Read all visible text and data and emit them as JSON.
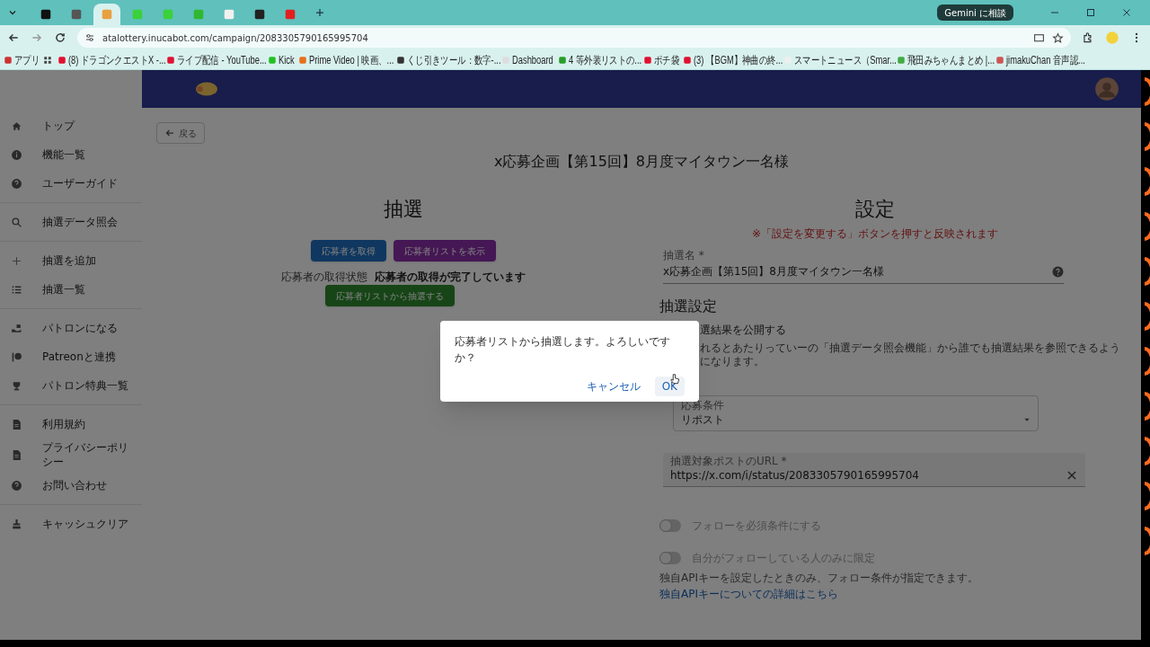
{
  "browser": {
    "tabs": [
      {
        "selected": false
      },
      {
        "selected": false
      },
      {
        "selected": true
      },
      {
        "selected": false
      },
      {
        "selected": false
      },
      {
        "selected": false
      },
      {
        "selected": false
      },
      {
        "selected": false
      },
      {
        "selected": false
      }
    ],
    "gemini_button": "Gemini に相談",
    "address": "atalottery.inucabot.com/campaign/2083305790165995704",
    "bookmarks": [
      "アプリ",
      "(8) ドラゴンクエストX -...",
      "ライブ配信 - YouTube...",
      "Kick",
      "Prime Video | 映画、...",
      "くじ引きツール：数字-...",
      "Dashboard",
      "4 等外装リストの...",
      "ポチ袋",
      "(3) 【BGM】神曲の終...",
      "スマートニュース（Smar...",
      "飛田みちゃんまとめ |...",
      "jimakuChan 音声認..."
    ]
  },
  "sidebar": {
    "groups": [
      [
        "トップ",
        "機能一覧",
        "ユーザーガイド"
      ],
      [
        "抽選データ照会"
      ],
      [
        "抽選を追加",
        "抽選一覧"
      ],
      [
        "パトロンになる",
        "Patreonと連携",
        "パトロン特典一覧"
      ],
      [
        "利用規約",
        "プライバシーポリシー",
        "お問い合わせ"
      ],
      [
        "キャッシュクリア"
      ]
    ]
  },
  "page": {
    "back_button": "戻る",
    "title": "x応募企画【第15回】8月度マイタウン一名様",
    "draw": {
      "heading": "抽選",
      "buttons": [
        "応募者を取得",
        "応募者リストを表示"
      ],
      "status_label": "応募者の取得状態",
      "status_value": "応募者の取得が完了しています",
      "draw_button": "応募者リストから抽選する"
    },
    "settings": {
      "heading": "設定",
      "notice": "※「設定を変更する」ボタンを押すと反映されます",
      "name_field": {
        "label": "抽選名 *",
        "value": "x応募企画【第15回】8月度マイタウン一名様"
      },
      "section_heading": "抽選設定",
      "publish_label": "選結果を公開する",
      "publish_note": "れるとあたりっていーの「抽選データ照会機能」から誰でも抽選結果を参照できるようになります。",
      "condition_select": {
        "label": "応募条件",
        "value": "リポスト"
      },
      "url_field": {
        "label": "抽選対象ポストのURL *",
        "value": "https://x.com/i/status/2083305790165995704"
      },
      "toggles": [
        {
          "label": "フォローを必須条件にする",
          "on": false,
          "disabled": true
        },
        {
          "label": "自分がフォローしている人のみに限定",
          "on": false,
          "disabled": true
        }
      ],
      "api_note": "独自APIキーを設定したときのみ、フォロー条件が指定できます。",
      "api_link": "独自APIキーについての詳細はこちら"
    }
  },
  "dialog": {
    "message": "応募者リストから抽選します。よろしいですか？",
    "buttons": [
      "キャンセル",
      "OK"
    ]
  }
}
